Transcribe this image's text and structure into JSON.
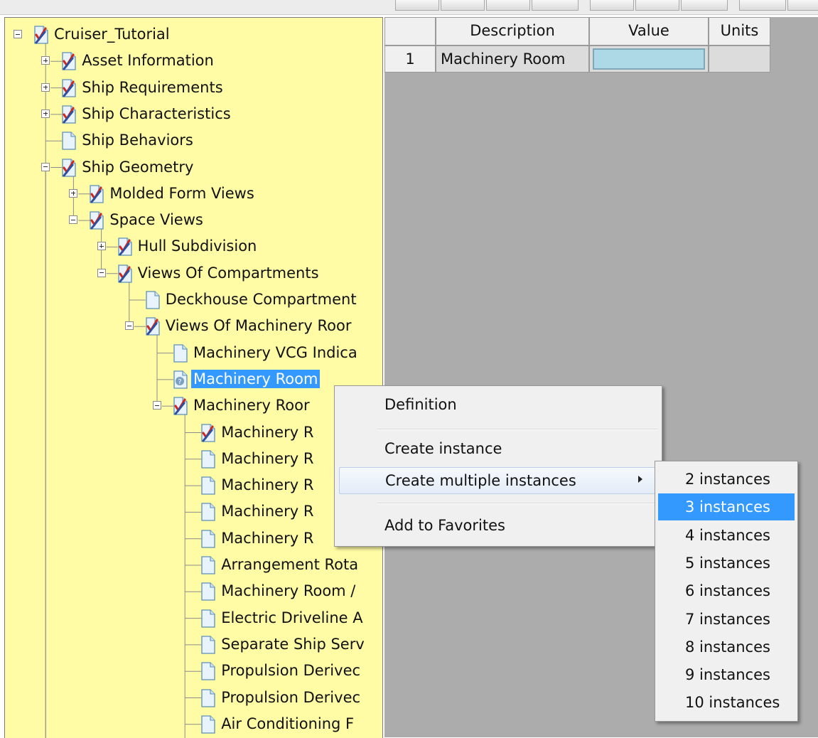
{
  "tree": {
    "nodes": [
      {
        "label": "Cruiser_Tutorial",
        "icon": "checked-document-icon",
        "expander": "minus",
        "name": "tree-node-cruiser-tutorial"
      },
      {
        "label": "Asset Information",
        "icon": "checked-document-icon",
        "expander": "plus",
        "name": "tree-node-asset-information"
      },
      {
        "label": "Ship Requirements",
        "icon": "checked-document-icon",
        "expander": "plus",
        "name": "tree-node-ship-requirements"
      },
      {
        "label": "Ship Characteristics",
        "icon": "checked-document-icon",
        "expander": "plus",
        "name": "tree-node-ship-characteristics"
      },
      {
        "label": "Ship Behaviors",
        "icon": "document-icon",
        "expander": "none",
        "name": "tree-node-ship-behaviors"
      },
      {
        "label": "Ship Geometry",
        "icon": "checked-document-icon",
        "expander": "minus",
        "name": "tree-node-ship-geometry"
      },
      {
        "label": "Molded Form Views",
        "icon": "checked-document-icon",
        "expander": "plus",
        "name": "tree-node-molded-form-views"
      },
      {
        "label": "Space Views",
        "icon": "checked-document-icon",
        "expander": "minus",
        "name": "tree-node-space-views"
      },
      {
        "label": "Hull Subdivision",
        "icon": "checked-document-icon",
        "expander": "plus",
        "name": "tree-node-hull-subdivision"
      },
      {
        "label": "Views Of Compartments",
        "icon": "checked-document-icon",
        "expander": "minus",
        "name": "tree-node-views-of-compartments"
      },
      {
        "label": "Deckhouse Compartment",
        "icon": "document-icon",
        "expander": "none",
        "name": "tree-node-deckhouse-compartment"
      },
      {
        "label": "Views Of Machinery Roor",
        "icon": "checked-document-icon",
        "expander": "minus",
        "name": "tree-node-views-of-machinery-room"
      },
      {
        "label": "Machinery VCG Indica",
        "icon": "document-icon",
        "expander": "none",
        "name": "tree-node-machinery-vcg"
      },
      {
        "label": "Machinery Room",
        "icon": "question-document-icon",
        "expander": "none",
        "name": "tree-node-machinery-room",
        "selected": true
      },
      {
        "label": "Machinery Roor",
        "icon": "checked-document-icon",
        "expander": "minus",
        "name": "tree-node-machinery-room-group"
      },
      {
        "label": "Machinery R",
        "icon": "checked-document-icon",
        "expander": "none",
        "name": "tree-node-machinery-r-1"
      },
      {
        "label": "Machinery R",
        "icon": "document-icon",
        "expander": "none",
        "name": "tree-node-machinery-r-2"
      },
      {
        "label": "Machinery R",
        "icon": "document-icon",
        "expander": "none",
        "name": "tree-node-machinery-r-3"
      },
      {
        "label": "Machinery R",
        "icon": "document-icon",
        "expander": "none",
        "name": "tree-node-machinery-r-4"
      },
      {
        "label": "Machinery R",
        "icon": "document-icon",
        "expander": "none",
        "name": "tree-node-machinery-r-5"
      },
      {
        "label": "Arrangement Rota",
        "icon": "document-icon",
        "expander": "none",
        "name": "tree-node-arrangement-rota"
      },
      {
        "label": "Machinery Room /",
        "icon": "document-icon",
        "expander": "none",
        "name": "tree-node-machinery-room-a"
      },
      {
        "label": "Electric Driveline A",
        "icon": "document-icon",
        "expander": "none",
        "name": "tree-node-electric-driveline"
      },
      {
        "label": "Separate Ship Serv",
        "icon": "document-icon",
        "expander": "none",
        "name": "tree-node-separate-ship-serv"
      },
      {
        "label": "Propulsion Derivec",
        "icon": "document-icon",
        "expander": "none",
        "name": "tree-node-propulsion-derived-1"
      },
      {
        "label": "Propulsion Derivec",
        "icon": "document-icon",
        "expander": "none",
        "name": "tree-node-propulsion-derived-2"
      },
      {
        "label": "Air Conditioning F",
        "icon": "document-icon",
        "expander": "none",
        "name": "tree-node-air-conditioning"
      }
    ]
  },
  "grid": {
    "headers": {
      "description": "Description",
      "value": "Value",
      "units": "Units"
    },
    "rows": [
      {
        "index": "1",
        "description": "Machinery Room",
        "value": "",
        "units": ""
      }
    ]
  },
  "context_menu": {
    "definition": "Definition",
    "create_instance": "Create instance",
    "create_multiple": "Create multiple instances",
    "add_favorites": "Add to Favorites"
  },
  "submenu": {
    "items": [
      "2 instances",
      "3 instances",
      "4 instances",
      "5 instances",
      "6 instances",
      "7 instances",
      "8 instances",
      "9 instances",
      "10 instances"
    ],
    "selected_index": 1
  },
  "colors": {
    "tree_background": "#fffca5",
    "selection": "#3399ff",
    "value_cell": "#add8e6",
    "grid_background": "#acacac"
  }
}
